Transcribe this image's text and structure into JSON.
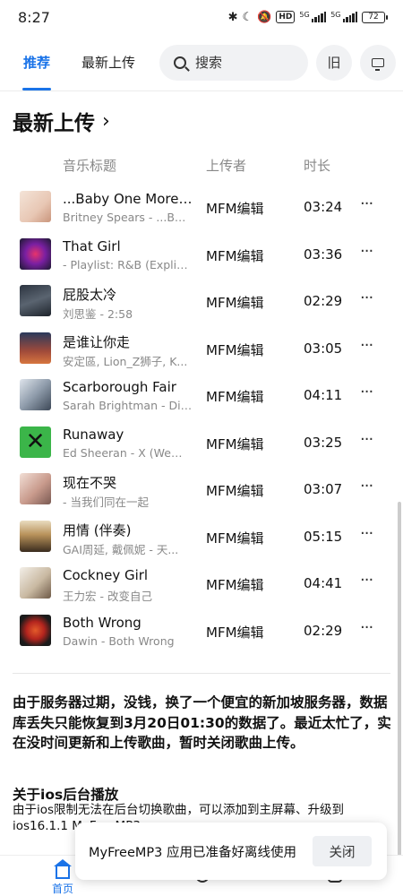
{
  "status_bar": {
    "time": "8:27",
    "hd": "HD",
    "net1": "5G",
    "net2": "5G",
    "battery": "72"
  },
  "header": {
    "tab_recommend": "推荐",
    "tab_latest": "最新上传",
    "search_placeholder": "搜索",
    "old_button": "旧"
  },
  "section": {
    "title": "最新上传",
    "columns": {
      "title": "音乐标题",
      "uploader": "上传者",
      "duration": "时长"
    }
  },
  "songs": [
    {
      "title": "...Baby One More Time",
      "subtitle": "Britney Spears - ...Baby One More Time",
      "uploader": "MFM编辑",
      "duration": "03:24",
      "more": "···"
    },
    {
      "title": "That Girl",
      "subtitle": "- Playlist: R&B (Explicit)",
      "uploader": "MFM编辑",
      "duration": "03:36",
      "more": "···"
    },
    {
      "title": "屁股太冷",
      "subtitle": "刘思鉴 - 2:58",
      "uploader": "MFM编辑",
      "duration": "02:29",
      "more": "···"
    },
    {
      "title": "是谁让你走",
      "subtitle": "安定區, Lion_Z狮子, K...",
      "uploader": "MFM编辑",
      "duration": "03:05",
      "more": "···"
    },
    {
      "title": "Scarborough Fair",
      "subtitle": "Sarah Brightman - Diva",
      "uploader": "MFM编辑",
      "duration": "04:11",
      "more": "···"
    },
    {
      "title": "Runaway",
      "subtitle": "Ed Sheeran - X (Wembley)",
      "uploader": "MFM编辑",
      "duration": "03:25",
      "more": "···"
    },
    {
      "title": "现在不哭",
      "subtitle": "- 当我们同在一起",
      "uploader": "MFM编辑",
      "duration": "03:07",
      "more": "···"
    },
    {
      "title": "用情 (伴奏)",
      "subtitle": "GAI周延, 戴佩妮 - 天...",
      "uploader": "MFM编辑",
      "duration": "05:15",
      "more": "···"
    },
    {
      "title": "Cockney Girl",
      "subtitle": "王力宏 - 改变自己",
      "uploader": "MFM编辑",
      "duration": "04:41",
      "more": "···"
    },
    {
      "title": "Both Wrong",
      "subtitle": "Dawin - Both Wrong",
      "uploader": "MFM编辑",
      "duration": "02:29",
      "more": "···"
    }
  ],
  "notice": "由于服务器过期，没钱，换了一个便宜的新加坡服务器，数据库丢失只能恢复到3月20日01:30的数据了。最近太忙了，实在没时间更新和上传歌曲，暂时关闭歌曲上传。",
  "ios": {
    "title": "关于ios后台播放",
    "text": "由于ios限制无法在后台切换歌曲，可以添加到主屏幕、升级到ios16.1.1 MyFreeMP3"
  },
  "bottom_nav": {
    "home": "首页"
  },
  "toast": {
    "message": "MyFreeMP3 应用已准备好离线使用",
    "close": "关闭"
  }
}
